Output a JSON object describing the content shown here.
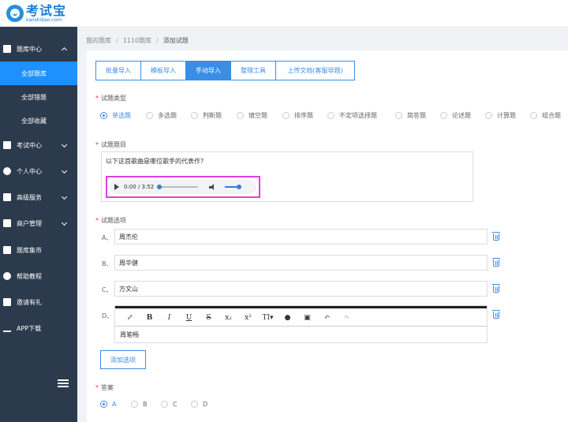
{
  "logo": {
    "cn": "考试宝",
    "en": "kaoshibao.com"
  },
  "sidebar": {
    "items": [
      {
        "label": "题库中心",
        "icon": "list-icon",
        "expanded": true
      },
      {
        "label": "全部题库",
        "active": true
      },
      {
        "label": "全部错题"
      },
      {
        "label": "全部收藏"
      },
      {
        "label": "考试中心",
        "icon": "layers-icon"
      },
      {
        "label": "个人中心",
        "icon": "user-icon"
      },
      {
        "label": "高级服务",
        "icon": "chart-icon"
      },
      {
        "label": "商户管理",
        "icon": "shop-icon"
      },
      {
        "label": "题库集市",
        "icon": "cube-icon"
      },
      {
        "label": "帮助教程",
        "icon": "help-icon"
      },
      {
        "label": "邀请有礼",
        "icon": "gift-icon"
      },
      {
        "label": "APP下载",
        "icon": "download-icon"
      }
    ]
  },
  "breadcrumb": {
    "items": [
      "我的题库",
      "1110题库",
      "添加试题"
    ],
    "sep": "/"
  },
  "tabs": [
    {
      "label": "批量导入",
      "active": false
    },
    {
      "label": "模板导入",
      "active": false
    },
    {
      "label": "手动导入",
      "active": true
    },
    {
      "label": "整理工具",
      "active": false
    },
    {
      "label": "上传文档(客服导题)",
      "active": false
    }
  ],
  "question_type": {
    "label": "试题类型",
    "options": [
      "单选题",
      "多选题",
      "判断题",
      "填空题",
      "排序题",
      "不定项选择题",
      "简答题",
      "论述题",
      "计算题",
      "组合题"
    ],
    "selected": "单选题"
  },
  "question": {
    "label": "试题题目",
    "text": "以下这首歌曲是哪位歌手的代表作?",
    "audio": {
      "time": "0:00 / 3:52"
    }
  },
  "options": {
    "label": "试题选项",
    "items": [
      {
        "letter": "A、",
        "value": "周杰伦"
      },
      {
        "letter": "B、",
        "value": "周华健"
      },
      {
        "letter": "C、",
        "value": "方文山"
      },
      {
        "letter": "D、",
        "value": "周笔畅"
      }
    ],
    "add_label": "添加选项"
  },
  "editor_toolbar": [
    "⤢",
    "B",
    "I",
    "U",
    "S",
    "x₂",
    "x²",
    "TI▾",
    "●",
    "▣",
    "↶",
    "↷"
  ],
  "answer": {
    "label": "答案",
    "options": [
      "A",
      "B",
      "C",
      "D"
    ],
    "selected": "A"
  },
  "colors": {
    "accent": "#3a8ee6",
    "sidebar": "#2b3a4d",
    "required": "#e03b3b",
    "highlight": "#e23fe0"
  }
}
